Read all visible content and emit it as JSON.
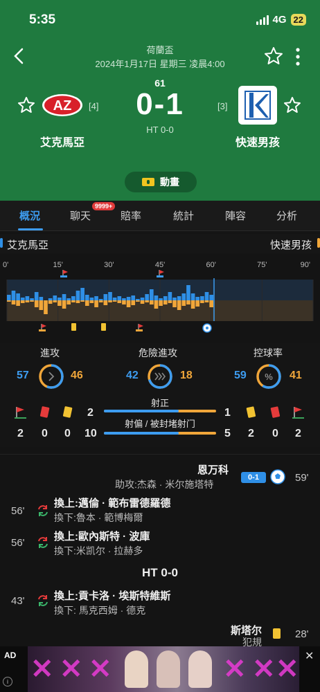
{
  "status_bar": {
    "time": "5:35",
    "network": "4G",
    "battery": "22"
  },
  "header": {
    "league": "荷蘭盃",
    "date": "2024年1月17日 星期三 凌晨4:00",
    "minute": "61",
    "score": "0-1",
    "half_time": "HT 0-0",
    "home": {
      "name": "艾克馬亞",
      "rank": "[4]"
    },
    "away": {
      "name": "快速男孩",
      "rank": "[3]"
    },
    "animation_label": "動畫"
  },
  "tabs": {
    "items": [
      "概況",
      "聊天",
      "賠率",
      "統計",
      "陣容",
      "分析"
    ],
    "active": "概況",
    "chat_badge": "9999+"
  },
  "momentum": {
    "home": "艾克馬亞",
    "away": "快速男孩",
    "ticks": [
      "0'",
      "15'",
      "30'",
      "45'",
      "60'",
      "75'",
      "90'"
    ]
  },
  "stats": {
    "attacks": {
      "label": "進攻",
      "home": "57",
      "away": "46"
    },
    "dangerous": {
      "label": "危險進攻",
      "home": "42",
      "away": "18"
    },
    "possession": {
      "label": "控球率",
      "home": "59",
      "away": "41"
    },
    "shots_on": {
      "label": "射正",
      "home": "2",
      "away": "1"
    },
    "shots_off": {
      "label": "射偏 / 被封堵射门",
      "home": "10",
      "away": "5"
    },
    "home_corners": "2",
    "home_red": "0",
    "home_yellow": "0",
    "away_yellow": "2",
    "away_red": "0",
    "away_corners": "2",
    "colors": {
      "home": "#3d9cf0",
      "away": "#f0a63a"
    }
  },
  "events": {
    "goal": {
      "player": "恩万科",
      "assist": "助攻:杰森 · 米尔施塔特",
      "score": "0-1",
      "minute": "59'"
    },
    "sub1": {
      "in": "換上:邁倫 · 範布雷德羅德",
      "out": "換下:魯本 · 範博梅爾",
      "minute": "56'"
    },
    "sub2": {
      "in": "換上:歐內斯特 · 波庫",
      "out": "換下:米凯尔 · 拉赫多",
      "minute": "56'"
    },
    "half_time": "HT 0-0",
    "sub3": {
      "in": "換上:貢卡洛 · 埃斯特維斯",
      "out": "換下: 馬克西姆 · 德克",
      "minute": "43'"
    },
    "card": {
      "player": "斯塔尔",
      "reason": "犯規",
      "minute": "28'"
    }
  },
  "ad": {
    "label": "AD",
    "info": "i"
  }
}
